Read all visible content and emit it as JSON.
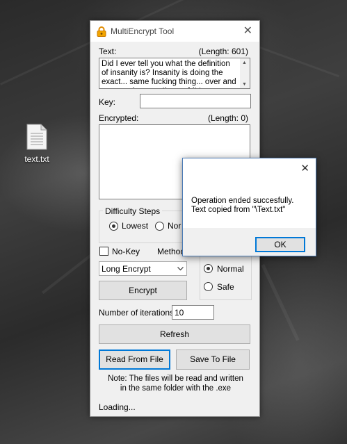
{
  "desktop": {
    "file_icon": "text-file-icon",
    "file_label": "text.txt"
  },
  "window": {
    "title": "MultiEncrypt Tool",
    "app_icon": "lock-icon",
    "close_glyph": "✕",
    "text_label": "Text:",
    "text_length": "(Length: 601)",
    "text_value": "Did I ever tell you what the definition of insanity is? Insanity is doing the exact... same fucking thing... over and over again expecting... shit to change... That. Is.",
    "key_label": "Key:",
    "key_value": "",
    "encrypted_label": "Encrypted:",
    "encrypted_length": "(Length: 0)",
    "encrypted_value": "",
    "difficulty_group": "Difficulty Steps",
    "difficulty_options": [
      "Lowest",
      "Nor"
    ],
    "difficulty_selected": "Lowest",
    "nokey_label": "No-Key",
    "method_label": "Method",
    "method_select": "Long Encrypt",
    "mode_options": [
      "Normal",
      "Safe"
    ],
    "mode_selected": "Normal",
    "encrypt_button": "Encrypt",
    "iterations_label": "Number of iterations:",
    "iterations_value": "10",
    "refresh_button": "Refresh",
    "read_button": "Read From File",
    "save_button": "Save To File",
    "note_line1": "Note: The files will be read and written",
    "note_line2": "in the same folder with the .exe",
    "status": "Loading..."
  },
  "dialog": {
    "close_glyph": "✕",
    "line1": "Operation ended succesfully.",
    "line2": "Text copied from \"\\Text.txt\"",
    "ok_button": "OK"
  },
  "colors": {
    "focus": "#0078d7",
    "window_bg": "#f0f0f0",
    "control_bg": "#e1e1e1"
  }
}
